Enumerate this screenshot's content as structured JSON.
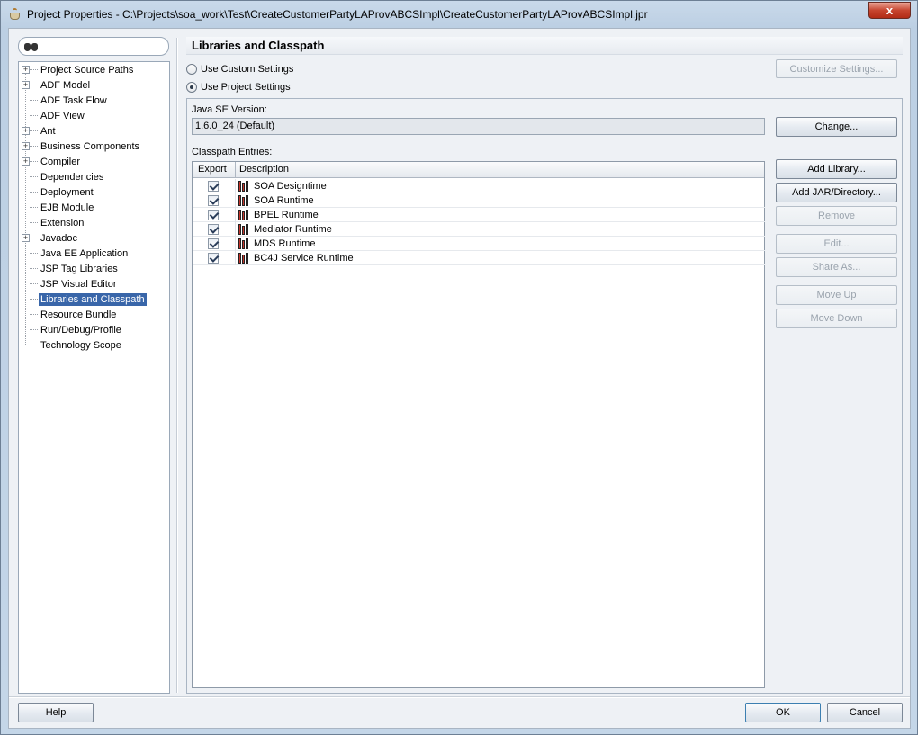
{
  "window": {
    "title": "Project Properties - C:\\Projects\\soa_work\\Test\\CreateCustomerPartyLAProvABCSImpl\\CreateCustomerPartyLAProvABCSImpl.jpr",
    "close_label": "x"
  },
  "search": {
    "value": "",
    "icon": "binoculars-icon"
  },
  "tree": {
    "items": [
      {
        "label": "Project Source Paths",
        "expandable": true
      },
      {
        "label": "ADF Model",
        "expandable": true
      },
      {
        "label": "ADF Task Flow",
        "expandable": false
      },
      {
        "label": "ADF View",
        "expandable": false
      },
      {
        "label": "Ant",
        "expandable": true
      },
      {
        "label": "Business Components",
        "expandable": true
      },
      {
        "label": "Compiler",
        "expandable": true
      },
      {
        "label": "Dependencies",
        "expandable": false
      },
      {
        "label": "Deployment",
        "expandable": false
      },
      {
        "label": "EJB Module",
        "expandable": false
      },
      {
        "label": "Extension",
        "expandable": false
      },
      {
        "label": "Javadoc",
        "expandable": true
      },
      {
        "label": "Java EE Application",
        "expandable": false
      },
      {
        "label": "JSP Tag Libraries",
        "expandable": false
      },
      {
        "label": "JSP Visual Editor",
        "expandable": false
      },
      {
        "label": "Libraries and Classpath",
        "expandable": false,
        "selected": true
      },
      {
        "label": "Resource Bundle",
        "expandable": false
      },
      {
        "label": "Run/Debug/Profile",
        "expandable": false
      },
      {
        "label": "Technology Scope",
        "expandable": false
      }
    ]
  },
  "panel": {
    "title": "Libraries and Classpath",
    "use_custom_label": "Use Custom Settings",
    "use_project_label": "Use Project Settings",
    "selected_setting": "Use Project Settings",
    "customize_label": "Customize Settings...",
    "java_se_label": "Java SE Version:",
    "java_se_value": "1.6.0_24 (Default)",
    "change_label": "Change...",
    "classpath_label": "Classpath Entries:",
    "columns": {
      "export": "Export",
      "description": "Description"
    },
    "entries": [
      {
        "export": true,
        "description": "SOA Designtime"
      },
      {
        "export": true,
        "description": "SOA Runtime"
      },
      {
        "export": true,
        "description": "BPEL Runtime"
      },
      {
        "export": true,
        "description": "Mediator Runtime"
      },
      {
        "export": true,
        "description": "MDS Runtime"
      },
      {
        "export": true,
        "description": "BC4J Service Runtime"
      }
    ],
    "buttons": {
      "add_library": "Add Library...",
      "add_jar": "Add JAR/Directory...",
      "remove": "Remove",
      "edit": "Edit...",
      "share_as": "Share As...",
      "move_up": "Move Up",
      "move_down": "Move Down"
    }
  },
  "footer": {
    "help": "Help",
    "ok": "OK",
    "cancel": "Cancel"
  }
}
